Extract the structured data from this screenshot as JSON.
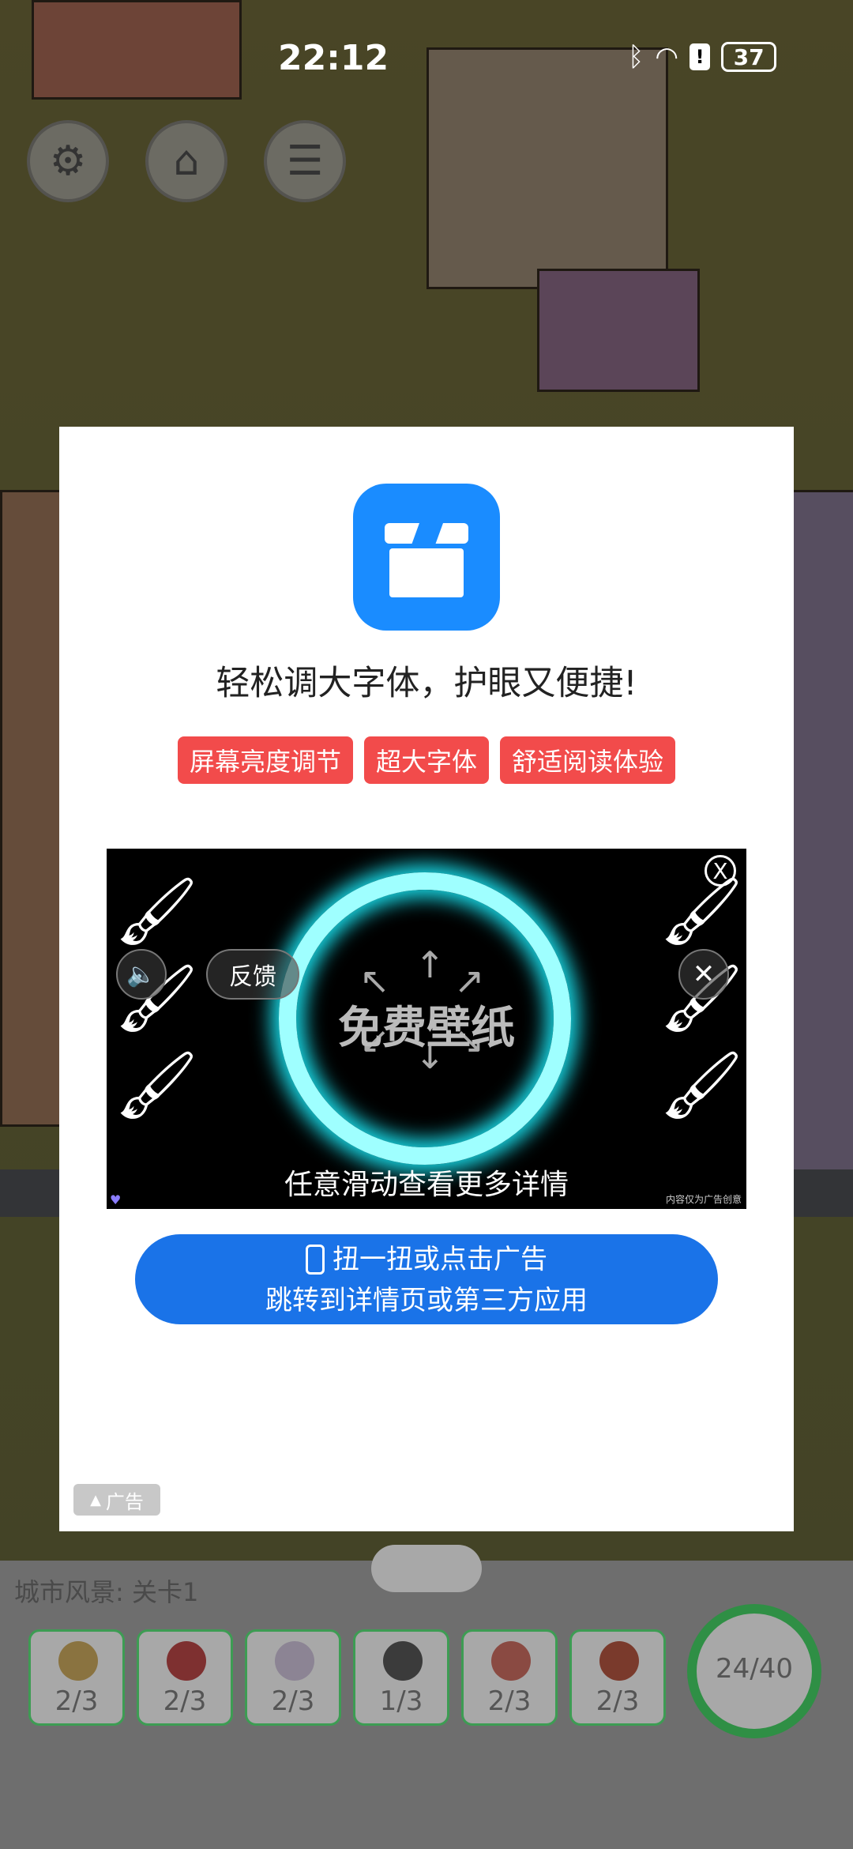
{
  "status_bar": {
    "time": "22:12",
    "battery": "37",
    "icons": [
      "bluetooth-icon",
      "wifi-icon",
      "alert-icon",
      "battery-icon"
    ]
  },
  "game": {
    "top_buttons": [
      "settings-icon",
      "home-icon",
      "menu-icon"
    ],
    "level_label": "城市风景: 关卡1",
    "items": [
      {
        "icon": "hat-icon",
        "count": "2/3",
        "color": "#d4a83a"
      },
      {
        "icon": "strawberry-icon",
        "count": "2/3",
        "color": "#c83a3a"
      },
      {
        "icon": "garlic-icon",
        "count": "2/3",
        "color": "#d8c8e8"
      },
      {
        "icon": "seed-icon",
        "count": "1/3",
        "color": "#333333"
      },
      {
        "icon": "butterfly-icon",
        "count": "2/3",
        "color": "#d86a5a"
      },
      {
        "icon": "meat-icon",
        "count": "2/3",
        "color": "#b8503a"
      }
    ],
    "progress": "24/40",
    "progress_fraction": 0.6
  },
  "ad": {
    "headline": "轻松调大字体，护眼又便捷!",
    "tags": [
      "屏幕亮度调节",
      "超大字体",
      "舒适阅读体验"
    ],
    "video": {
      "center_text": "免费壁纸",
      "caption": "任意滑动查看更多详情",
      "feedback_label": "反馈",
      "close_symbol": "X",
      "note": "内容仅为广告创意"
    },
    "cta_line1": "扭一扭或点击广告",
    "cta_line2": "跳转到详情页或第三方应用",
    "badge": "广告",
    "colors": {
      "accent": "#1a73e8",
      "tag": "#f24b4b",
      "app_icon": "#1a8cff",
      "neon": "#18d9e6"
    }
  }
}
